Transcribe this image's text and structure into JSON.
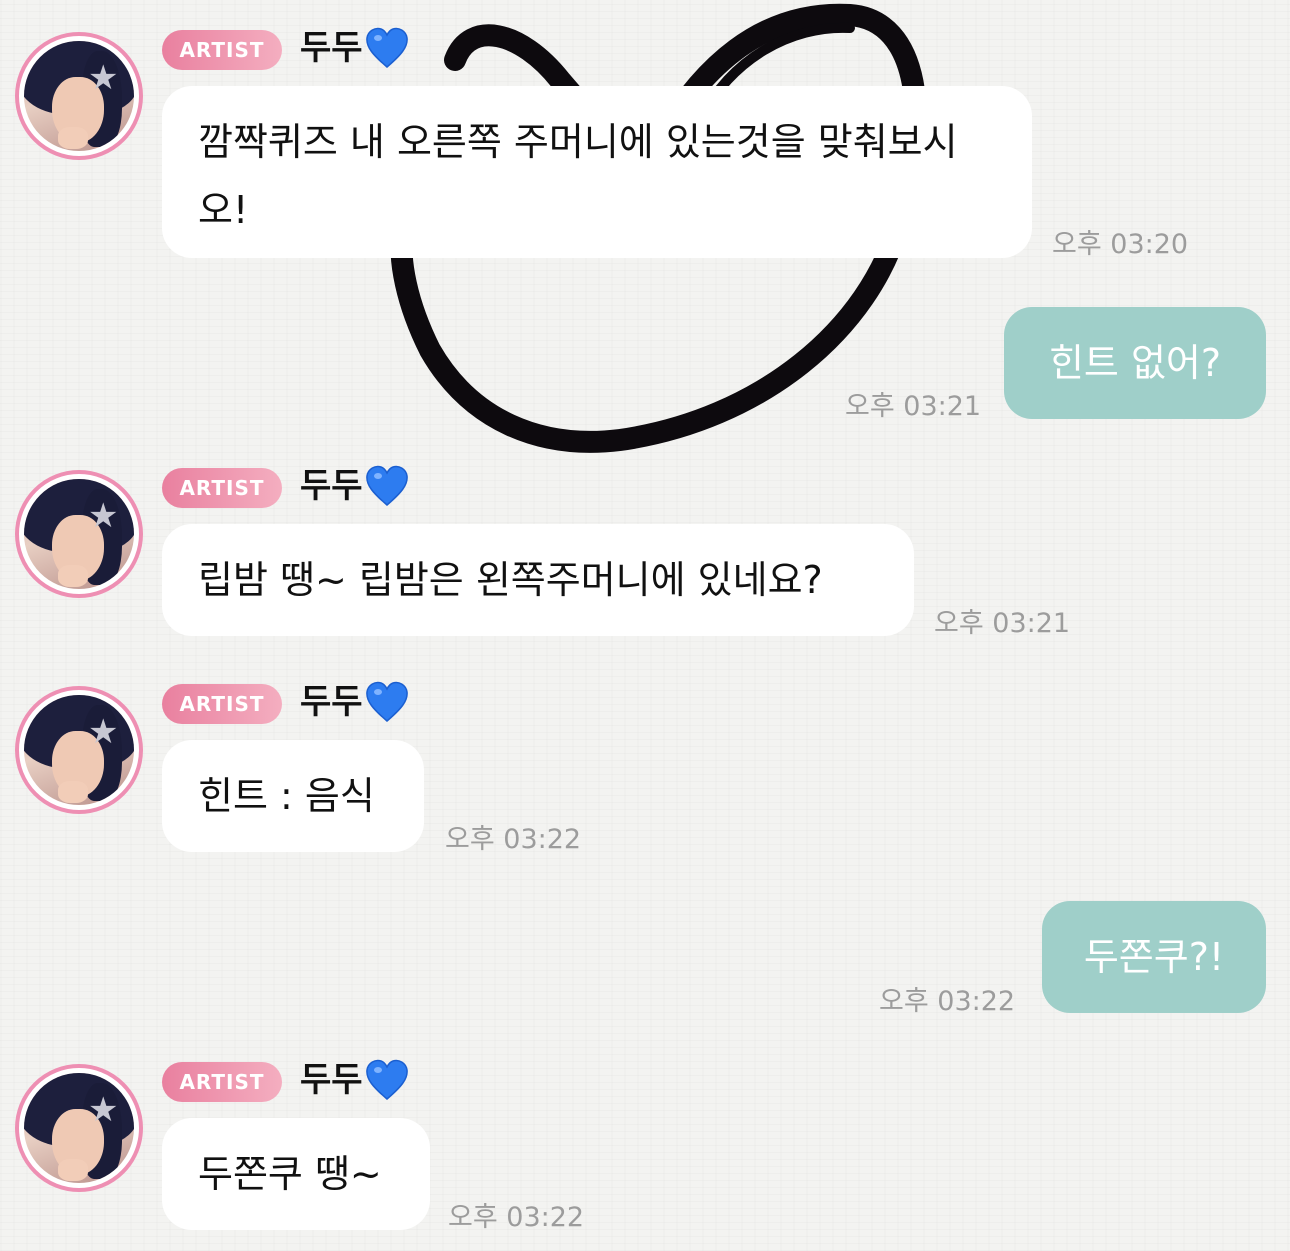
{
  "chat": {
    "badge_label": "ARTIST",
    "artist_name": "두두",
    "name_emoji": "blue-heart-icon",
    "colors": {
      "badge": "#e9809f",
      "my_bubble": "#9fcfc9",
      "avatar_ring": "#ee8fb3",
      "timestamp": "#9c9c9c"
    },
    "messages": [
      {
        "from": "artist",
        "text": "깜짝퀴즈 내 오른쪽 주머니에 있는것을 맞춰보시오!",
        "time": "오후 03:20"
      },
      {
        "from": "me",
        "text": "힌트 없어?",
        "time": "오후 03:21"
      },
      {
        "from": "artist",
        "text": "립밤 땡~ 립밤은 왼쪽주머니에 있네요?",
        "time": "오후 03:21"
      },
      {
        "from": "artist",
        "text": "힌트 : 음식",
        "time": "오후 03:22"
      },
      {
        "from": "me",
        "text": "두쫀쿠?!",
        "time": "오후 03:22"
      },
      {
        "from": "artist",
        "text": "두쫀쿠 땡~",
        "time": "오후 03:22"
      }
    ]
  }
}
